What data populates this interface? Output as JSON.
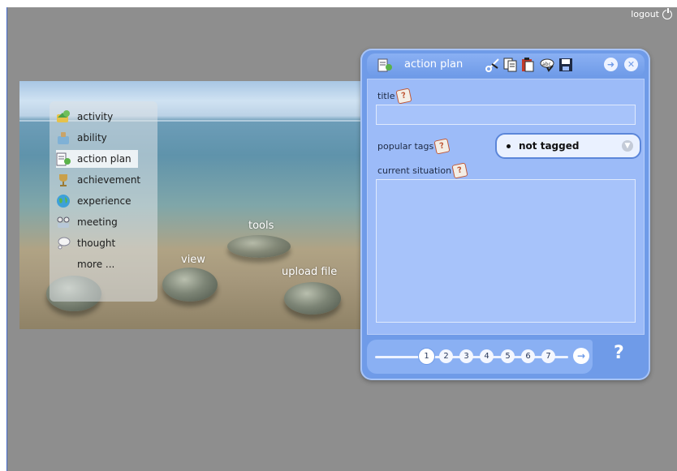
{
  "header": {
    "logout_label": "logout"
  },
  "nav": {
    "items": [
      {
        "label": "activity",
        "icon": "activity-icon"
      },
      {
        "label": "ability",
        "icon": "ability-icon"
      },
      {
        "label": "action plan",
        "icon": "action-plan-icon",
        "active": true
      },
      {
        "label": "achievement",
        "icon": "trophy-icon"
      },
      {
        "label": "experience",
        "icon": "globe-icon"
      },
      {
        "label": "meeting",
        "icon": "meeting-icon"
      },
      {
        "label": "thought",
        "icon": "thought-bubble-icon"
      },
      {
        "label": "more ...",
        "icon": ""
      }
    ]
  },
  "scene": {
    "tools_label": "tools",
    "view_label": "view",
    "upload_label": "upload file"
  },
  "dialog": {
    "title": "action plan",
    "toolbar_icons": [
      "cut-icon",
      "copy-icon",
      "paste-icon",
      "spellcheck-icon",
      "save-icon",
      "forward-icon",
      "close-icon"
    ],
    "form": {
      "title_label": "title",
      "title_value": "",
      "tags_label": "popular tags",
      "tags_selected": "not tagged",
      "situation_label": "current situation",
      "situation_value": ""
    },
    "pager": {
      "pages": [
        "1",
        "2",
        "3",
        "4",
        "5",
        "6",
        "7"
      ],
      "current_page": "1",
      "help_label": "?"
    }
  },
  "colors": {
    "stage_bg": "#8e8e8e",
    "dialog_bg": "#6f9be8",
    "content_bg": "#9cbbf8"
  }
}
